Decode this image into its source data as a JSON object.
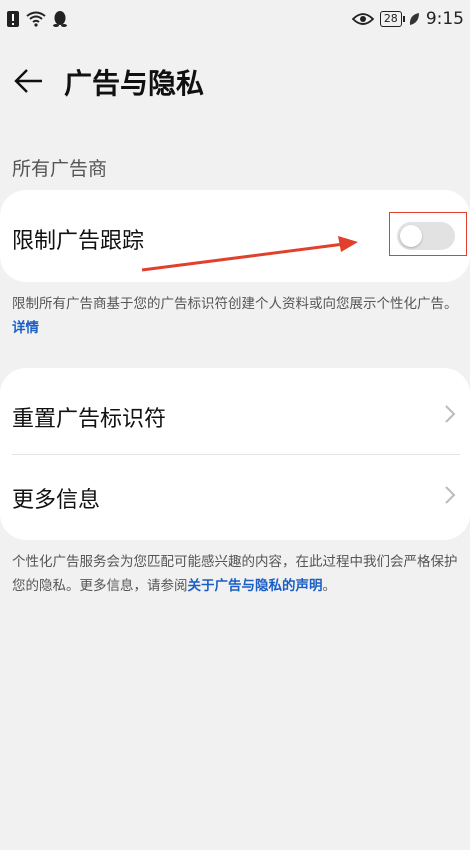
{
  "status": {
    "time": "9:15",
    "battery": "28"
  },
  "header": {
    "title": "广告与隐私"
  },
  "section": {
    "label": "所有广告商"
  },
  "limit_tracking": {
    "label": "限制广告跟踪",
    "enabled": false,
    "desc_text": "限制所有广告商基于您的广告标识符创建个人资料或向您展示个性化广告。",
    "desc_link": "详情"
  },
  "list": {
    "items": [
      {
        "label": "重置广告标识符"
      },
      {
        "label": "更多信息"
      }
    ]
  },
  "footer": {
    "text": "个性化广告服务会为您匹配可能感兴趣的内容，在此过程中我们会严格保护您的隐私。更多信息，请参阅",
    "link": "关于广告与隐私的声明",
    "end": "。"
  },
  "colors": {
    "accent_link": "#1a5fc6",
    "annotation_red": "#e0402c"
  }
}
